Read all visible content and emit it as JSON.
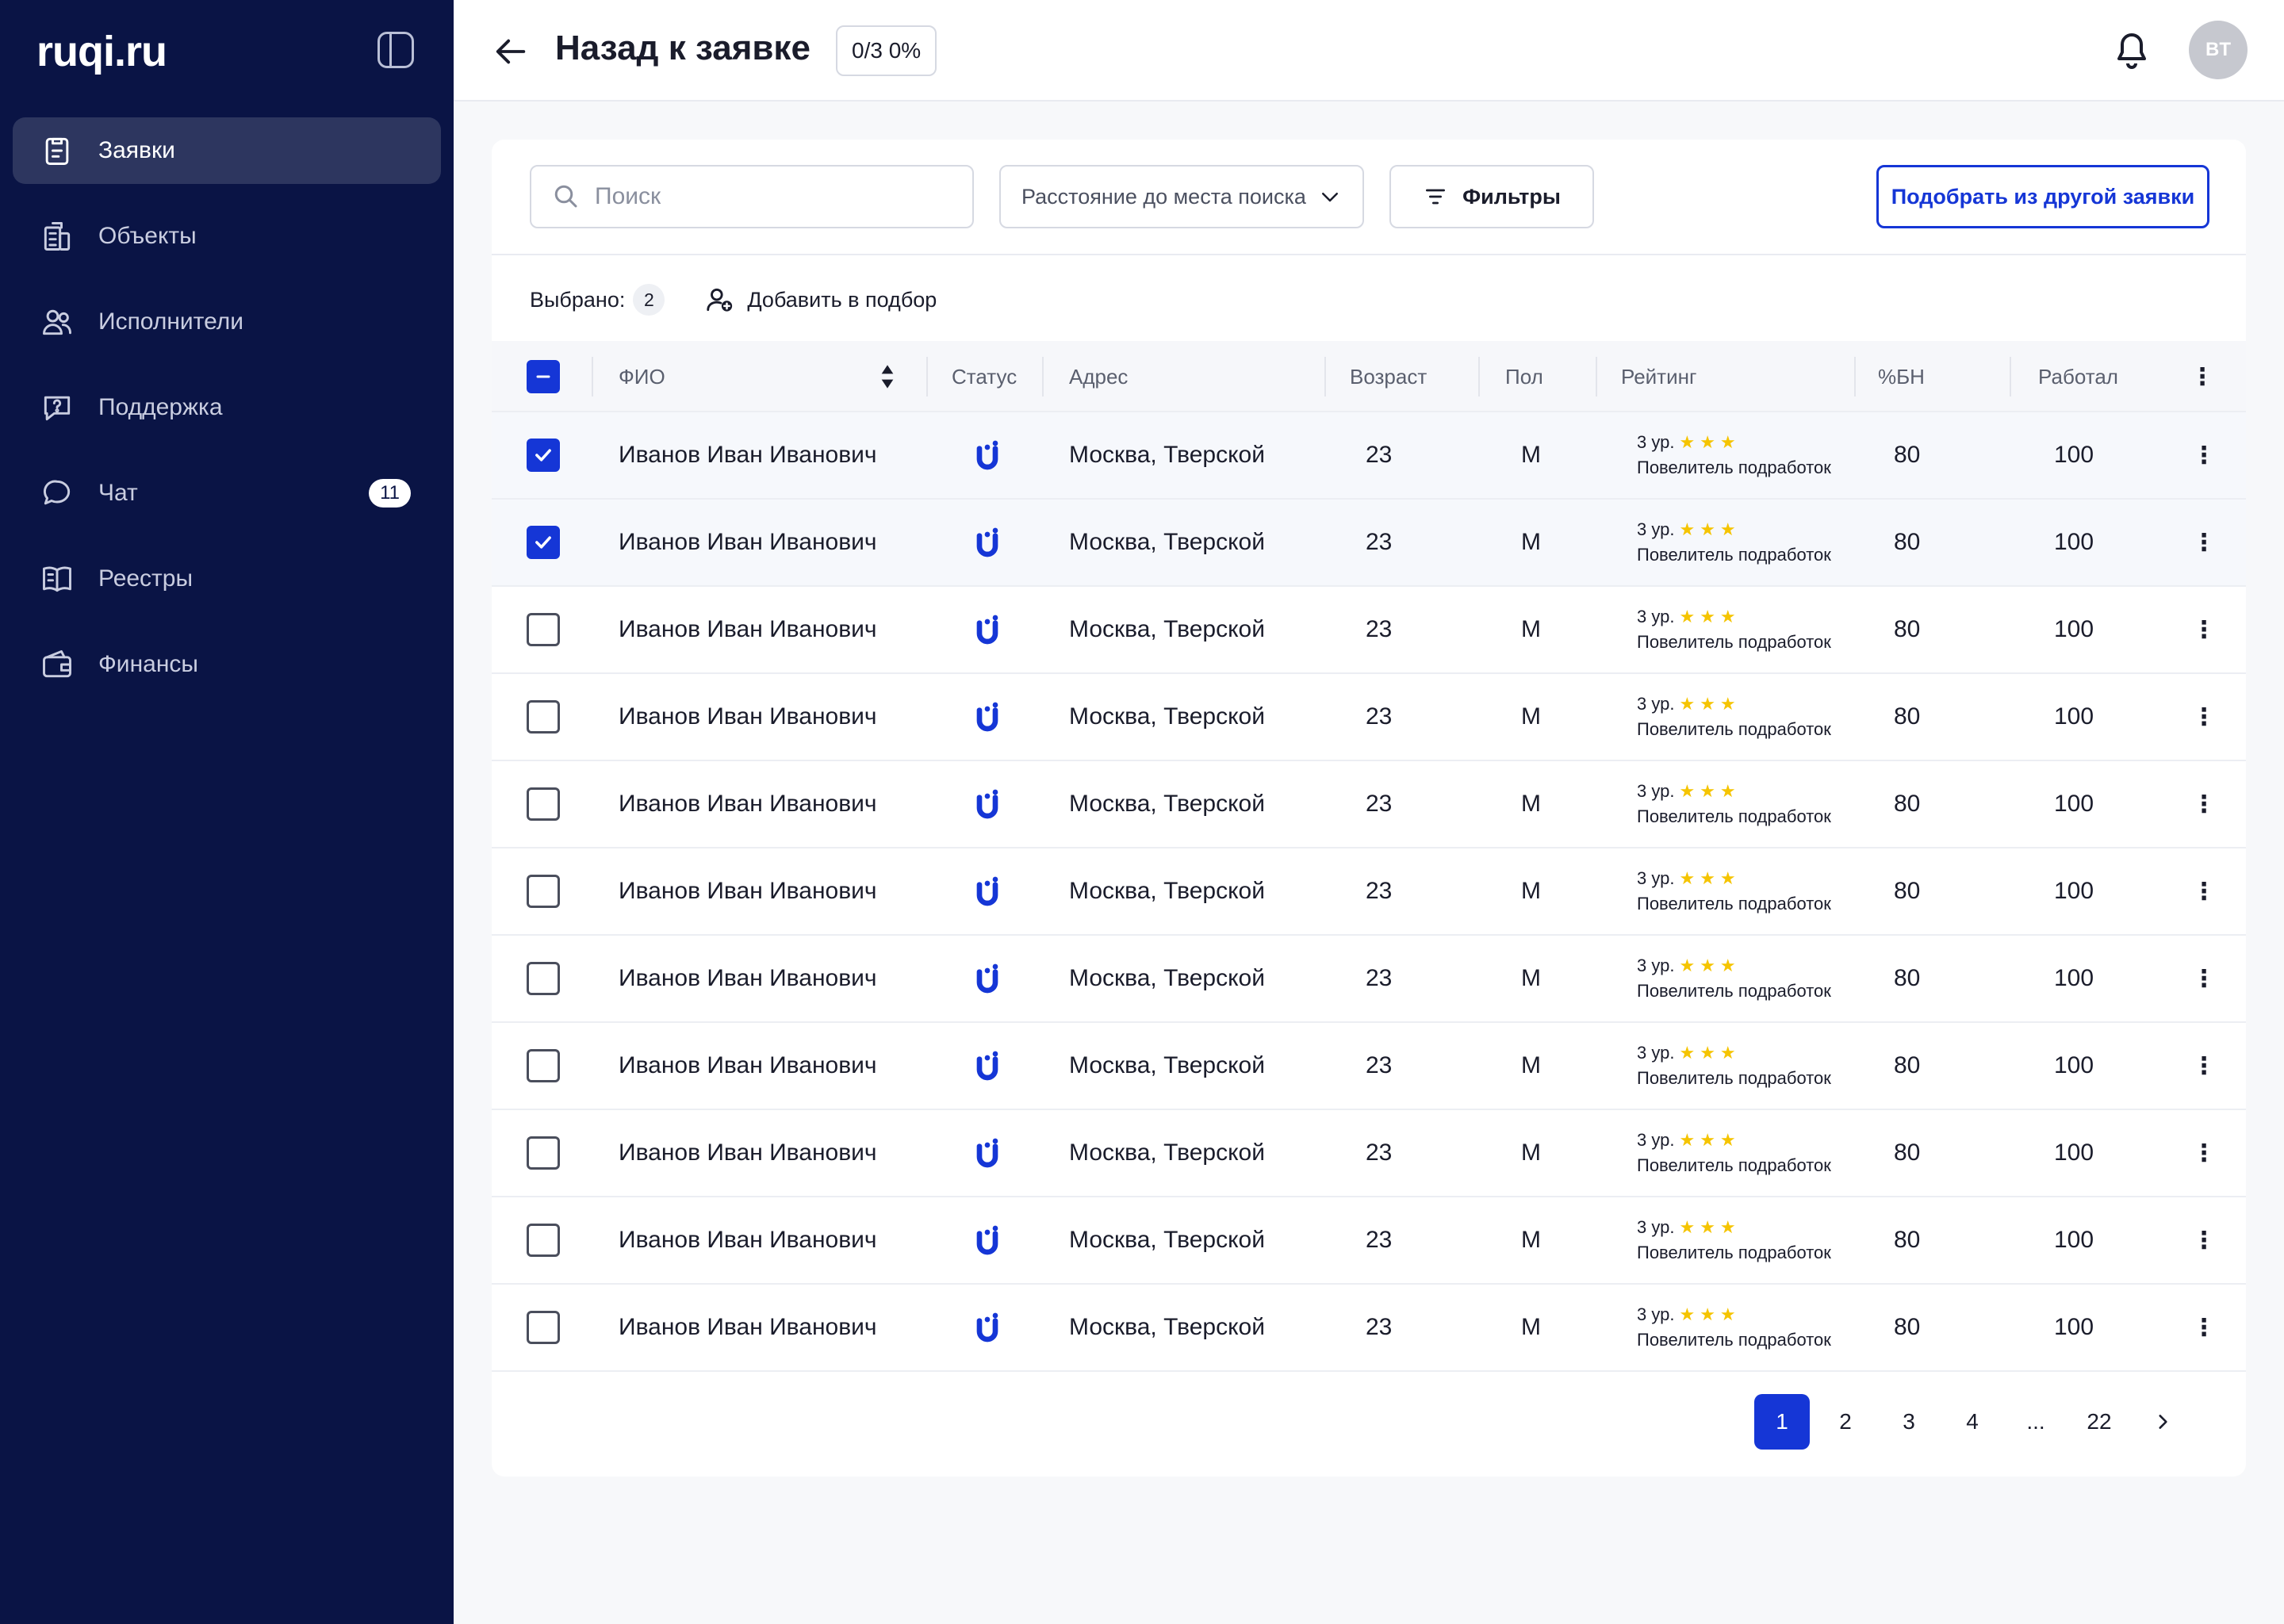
{
  "brand": {
    "logo_text": "ruqi.ru"
  },
  "sidebar": {
    "items": [
      {
        "label": "Заявки",
        "icon": "clipboard-icon",
        "active": true
      },
      {
        "label": "Объекты",
        "icon": "buildings-icon"
      },
      {
        "label": "Исполнители",
        "icon": "users-icon"
      },
      {
        "label": "Поддержка",
        "icon": "support-chat-icon"
      },
      {
        "label": "Чат",
        "icon": "chat-icon",
        "badge": "11"
      },
      {
        "label": "Реестры",
        "icon": "book-icon"
      },
      {
        "label": "Финансы",
        "icon": "wallet-icon"
      }
    ]
  },
  "header": {
    "back_title": "Назад к заявке",
    "progress": "0/3 0%",
    "avatar_initials": "BT"
  },
  "toolbar": {
    "search_placeholder": "Поиск",
    "distance_select": "Расстояние до места поиска",
    "filters_label": "Фильтры",
    "pick_other_label": "Подобрать из другой заявки"
  },
  "selection": {
    "label": "Выбрано:",
    "count": "2",
    "add_label": "Добавить в подбор"
  },
  "table": {
    "columns": {
      "name": "ФИО",
      "status": "Статус",
      "address": "Адрес",
      "age": "Возраст",
      "gender": "Пол",
      "rating": "Рейтинг",
      "bn": "%БН",
      "worked": "Работал"
    },
    "rows": [
      {
        "checked": true,
        "name": "Иванов Иван Иванович",
        "address": "Москва, Тверской",
        "age": "23",
        "gender": "М",
        "level": "3 ур.",
        "stars": 3,
        "rank": "Повелитель подработок",
        "bn": "80",
        "worked": "100"
      },
      {
        "checked": true,
        "name": "Иванов Иван Иванович",
        "address": "Москва, Тверской",
        "age": "23",
        "gender": "М",
        "level": "3 ур.",
        "stars": 3,
        "rank": "Повелитель подработок",
        "bn": "80",
        "worked": "100"
      },
      {
        "checked": false,
        "name": "Иванов Иван Иванович",
        "address": "Москва, Тверской",
        "age": "23",
        "gender": "М",
        "level": "3 ур.",
        "stars": 3,
        "rank": "Повелитель подработок",
        "bn": "80",
        "worked": "100"
      },
      {
        "checked": false,
        "name": "Иванов Иван Иванович",
        "address": "Москва, Тверской",
        "age": "23",
        "gender": "М",
        "level": "3 ур.",
        "stars": 3,
        "rank": "Повелитель подработок",
        "bn": "80",
        "worked": "100"
      },
      {
        "checked": false,
        "name": "Иванов Иван Иванович",
        "address": "Москва, Тверской",
        "age": "23",
        "gender": "М",
        "level": "3 ур.",
        "stars": 3,
        "rank": "Повелитель подработок",
        "bn": "80",
        "worked": "100"
      },
      {
        "checked": false,
        "name": "Иванов Иван Иванович",
        "address": "Москва, Тверской",
        "age": "23",
        "gender": "М",
        "level": "3 ур.",
        "stars": 3,
        "rank": "Повелитель подработок",
        "bn": "80",
        "worked": "100"
      },
      {
        "checked": false,
        "name": "Иванов Иван Иванович",
        "address": "Москва, Тверской",
        "age": "23",
        "gender": "М",
        "level": "3 ур.",
        "stars": 3,
        "rank": "Повелитель подработок",
        "bn": "80",
        "worked": "100"
      },
      {
        "checked": false,
        "name": "Иванов Иван Иванович",
        "address": "Москва, Тверской",
        "age": "23",
        "gender": "М",
        "level": "3 ур.",
        "stars": 3,
        "rank": "Повелитель подработок",
        "bn": "80",
        "worked": "100"
      },
      {
        "checked": false,
        "name": "Иванов Иван Иванович",
        "address": "Москва, Тверской",
        "age": "23",
        "gender": "М",
        "level": "3 ур.",
        "stars": 3,
        "rank": "Повелитель подработок",
        "bn": "80",
        "worked": "100"
      },
      {
        "checked": false,
        "name": "Иванов Иван Иванович",
        "address": "Москва, Тверской",
        "age": "23",
        "gender": "М",
        "level": "3 ур.",
        "stars": 3,
        "rank": "Повелитель подработок",
        "bn": "80",
        "worked": "100"
      },
      {
        "checked": false,
        "name": "Иванов Иван Иванович",
        "address": "Москва, Тверской",
        "age": "23",
        "gender": "М",
        "level": "3 ур.",
        "stars": 3,
        "rank": "Повелитель подработок",
        "bn": "80",
        "worked": "100"
      }
    ]
  },
  "pagination": {
    "pages": [
      "1",
      "2",
      "3",
      "4",
      "...",
      "22"
    ],
    "current": "1"
  },
  "colors": {
    "sidebar_bg": "#0a1445",
    "accent": "#1536d6",
    "star": "#f5c400"
  }
}
